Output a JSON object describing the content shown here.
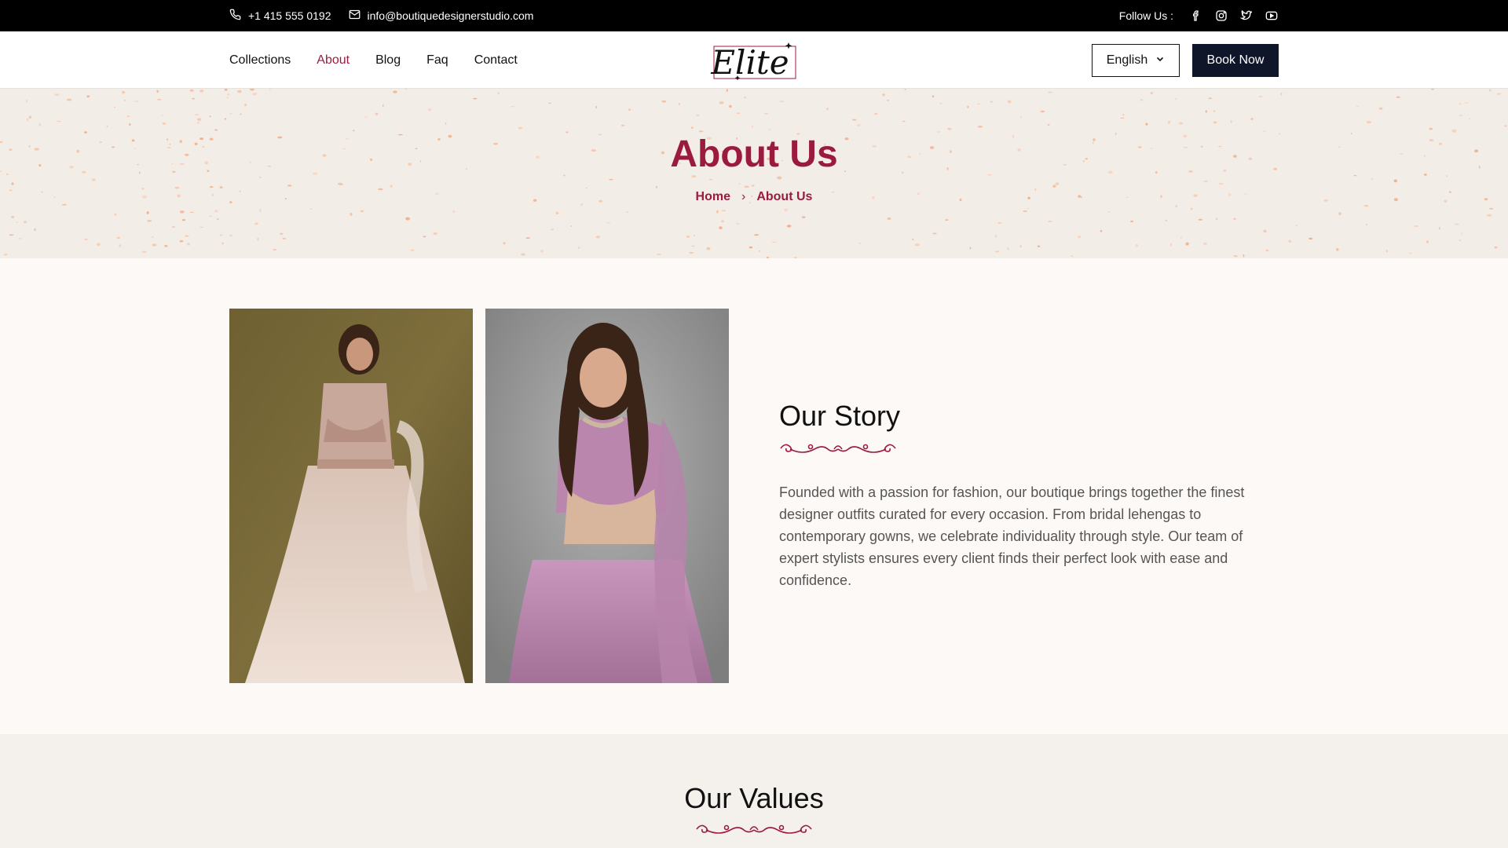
{
  "topbar": {
    "phone": "+1 415 555 0192",
    "email": "info@boutiquedesignerstudio.com",
    "follow_label": "Follow Us :",
    "social": [
      "facebook-icon",
      "instagram-icon",
      "twitter-icon",
      "youtube-icon"
    ]
  },
  "nav": {
    "items": [
      {
        "label": "Collections",
        "active": false
      },
      {
        "label": "About",
        "active": true
      },
      {
        "label": "Blog",
        "active": false
      },
      {
        "label": "Faq",
        "active": false
      },
      {
        "label": "Contact",
        "active": false
      }
    ],
    "logo_text": "Elite",
    "language": "English",
    "book_label": "Book Now"
  },
  "hero": {
    "title": "About Us",
    "breadcrumb": {
      "home": "Home",
      "separator": "›",
      "current": "About Us"
    }
  },
  "story": {
    "heading": "Our Story",
    "body": "Founded with a passion for fashion, our boutique brings together the finest designer outfits curated for every occasion. From bridal lehengas to contemporary gowns, we celebrate individuality through style. Our team of expert stylists ensures every client finds their perfect look with ease and confidence."
  },
  "values": {
    "heading": "Our Values"
  },
  "colors": {
    "accent": "#9b1b3f",
    "dark_button": "#0f1629",
    "topbar": "#000000",
    "hero_bg": "#f3ede8",
    "page_bg": "#fdf9f6"
  }
}
